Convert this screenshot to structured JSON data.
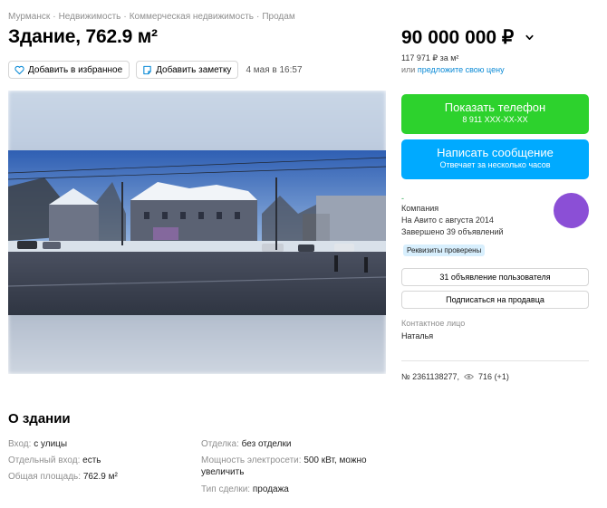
{
  "breadcrumbs": [
    "Мурманск",
    "Недвижимость",
    "Коммерческая недвижимость",
    "Продам"
  ],
  "breadcrumb_separator": "·",
  "title": "Здание, 762.9 м²",
  "actions": {
    "favorite_label": "Добавить в избранное",
    "note_label": "Добавить заметку",
    "date": "4 мая в 16:57"
  },
  "price": {
    "value": "90 000 000 ₽",
    "per_sqm": "117 971 ₽ за м²",
    "suggest_prefix": "или",
    "suggest_link": "предложите свою цену"
  },
  "contact_buttons": {
    "phone_label": "Показать телефон",
    "phone_number": "8 911 XXX-XX-XX",
    "message_label": "Написать сообщение",
    "message_sub": "Отвечает за несколько часов"
  },
  "seller": {
    "dash": "-",
    "type": "Компания",
    "since": "На Авито с августа 2014",
    "completed": "Завершено 39 объявлений",
    "badge": "Реквизиты проверены",
    "avatar_color": "#8b4fd6"
  },
  "seller_buttons": {
    "user_ads": "31 объявление пользователя",
    "subscribe": "Подписаться на продавца"
  },
  "contact_person": {
    "label": "Контактное лицо",
    "name": "Наталья"
  },
  "ad_meta": {
    "number": "№ 2361138277,",
    "views": "716 (+1)"
  },
  "about": {
    "title": "О здании",
    "left": [
      {
        "key": "Вход:",
        "value": "с улицы"
      },
      {
        "key": "Отдельный вход:",
        "value": "есть"
      },
      {
        "key": "Общая площадь:",
        "value": "762.9 м²"
      }
    ],
    "right": [
      {
        "key": "Отделка:",
        "value": "без отделки"
      },
      {
        "key": "Мощность электросети:",
        "value": "500 кВт, можно",
        "value2": "увеличить"
      },
      {
        "key": "Тип сделки:",
        "value": "продажа"
      }
    ]
  },
  "colors": {
    "green_button": "#2dd22d",
    "blue_button": "#00aaff",
    "link": "#0a8ad6",
    "badge_bg": "#d8effd"
  },
  "icons": [
    "heart-icon",
    "note-icon",
    "chevron-down-icon",
    "eye-icon"
  ]
}
